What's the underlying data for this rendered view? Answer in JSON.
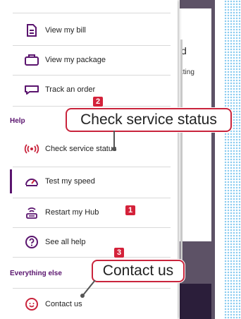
{
  "menu": {
    "items_top": [
      {
        "label": "View my bill",
        "icon": "bill-icon"
      },
      {
        "label": "View my package",
        "icon": "package-icon"
      },
      {
        "label": "Track an order",
        "icon": "order-icon"
      }
    ],
    "help_heading": "Help",
    "help_items": [
      {
        "label": "Check service status",
        "icon": "service-status-icon"
      },
      {
        "label": "Test my speed",
        "icon": "speedometer-icon"
      },
      {
        "label": "Restart my Hub",
        "icon": "hub-icon"
      },
      {
        "label": "See all help",
        "icon": "help-icon"
      }
    ],
    "else_heading": "Everything else",
    "else_items": [
      {
        "label": "Contact us",
        "icon": "contact-icon"
      }
    ]
  },
  "callouts": {
    "check_service": {
      "badge": "2",
      "text": "Check service status"
    },
    "restart_hub": {
      "badge": "1"
    },
    "contact_us": {
      "badge": "3",
      "text": "Contact us"
    }
  },
  "background": {
    "line1": "d",
    "line2": "tting"
  },
  "colors": {
    "brand_purple": "#5a146e",
    "callout_red": "#c9243c",
    "dots_blue": "#7fc6ee"
  }
}
